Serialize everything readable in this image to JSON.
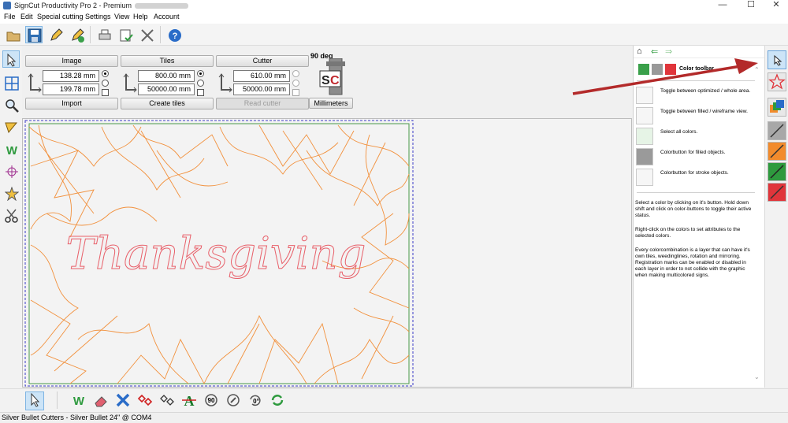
{
  "window": {
    "title": "SignCut Productivity Pro 2 - Premium",
    "minimize": "—",
    "maximize": "☐",
    "close": "✕"
  },
  "menu": [
    "File",
    "Edit",
    "Special cutting",
    "Settings",
    "View",
    "Help",
    "Account"
  ],
  "groups": {
    "image": {
      "title": "Image",
      "width": "138.28 mm",
      "height": "199.78 mm",
      "button": "Import"
    },
    "tiles": {
      "title": "Tiles",
      "width": "800.00 mm",
      "height": "50000.00 mm",
      "button": "Create tiles"
    },
    "cutter": {
      "title": "Cutter",
      "width": "610.00 mm",
      "height": "50000.00 mm",
      "button": "Read cutter"
    }
  },
  "rotation": {
    "label": "90 deg",
    "logo": "SC",
    "units_button": "Millimeters"
  },
  "design_text": "Thanksgiving",
  "help": {
    "title": "Color toolbar",
    "items": [
      {
        "icon": "optimized-toggle-icon",
        "text": "Toggle between optimized / whole area."
      },
      {
        "icon": "star-outline-icon",
        "text": "Toggle between filled / wireframe view."
      },
      {
        "icon": "all-colors-icon",
        "text": "Select all colors."
      },
      {
        "icon": "filled-color-icon",
        "text": "Colorbutton for filled objects."
      },
      {
        "icon": "stroke-color-icon",
        "text": "Colorbutton for stroke objects."
      }
    ],
    "paragraphs": [
      "Select a color by clicking on it's button. Hold down shift and click on color-buttons to toggle their active status.",
      "Right-click on the colors to set attributes to the selected colors.",
      "Every colorcombination is a layer that can have it's own tiles, weedinglines, rotation and mirroring. Registration marks can be enabled or disabled in each layer in order to not collide with the graphic when making multicolored signs."
    ]
  },
  "bottom": {
    "rotate_90": "90",
    "rotate_0": "0°"
  },
  "status": "Silver Bullet Cutters - Silver Bullet 24\" @ COM4",
  "colors": {
    "accent": "#0078d7",
    "design_orange": "#f2913d",
    "design_red": "#e8606a",
    "arrow": "#b32a2a",
    "stroke_gray": "#777777",
    "stroke_orange": "#f28b2c",
    "stroke_green": "#2e9a3e",
    "stroke_red": "#e0353b"
  }
}
